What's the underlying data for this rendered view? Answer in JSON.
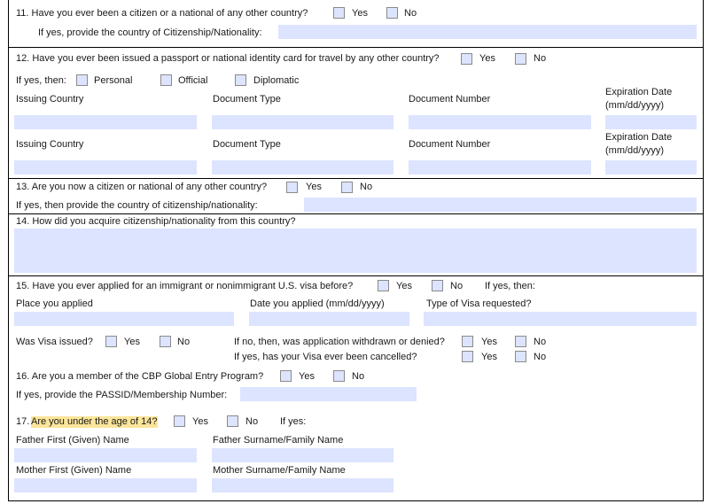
{
  "q11": {
    "text": "11. Have you ever been a citizen or a national of any other country?",
    "yes": "Yes",
    "no": "No",
    "followup": "If yes, provide the country of Citizenship/Nationality:"
  },
  "q12": {
    "text": "12. Have you ever been issued a passport or national identity card for travel by any other country?",
    "yes": "Yes",
    "no": "No",
    "if_yes": "If yes, then:",
    "personal": "Personal",
    "official": "Official",
    "diplomatic": "Diplomatic",
    "issuing_country": "Issuing Country",
    "document_type": "Document Type",
    "document_number": "Document Number",
    "exp_date_1": "Expiration Date",
    "exp_date_2": "(mm/dd/yyyy)"
  },
  "q13": {
    "text": "13. Are you now a citizen or national of any other country?",
    "yes": "Yes",
    "no": "No",
    "followup": "If yes, then provide the country of citizenship/nationality:"
  },
  "q14": {
    "text": "14. How did you acquire citizenship/nationality from this country?"
  },
  "q15": {
    "text": "15. Have you ever applied for an immigrant or nonimmigrant U.S. visa before?",
    "yes": "Yes",
    "no": "No",
    "if_yes_then": "If yes, then:",
    "place": "Place you applied",
    "date": "Date you applied (mm/dd/yyyy)",
    "visa_type": "Type of Visa requested?",
    "visa_issued": "Was Visa issued?",
    "if_no": "If no, then, was application withdrawn or denied?",
    "cancelled": "If yes, has your Visa ever been cancelled?"
  },
  "q16": {
    "text": "16. Are you a member of the CBP Global Entry Program?",
    "yes": "Yes",
    "no": "No",
    "followup": "If yes, provide the PASSID/Membership Number:"
  },
  "q17": {
    "number": "17.",
    "text": "Are you under the age of 14?",
    "yes": "Yes",
    "no": "No",
    "if_yes": "If yes:",
    "father_first": "Father First (Given) Name",
    "father_surname": "Father Surname/Family Name",
    "mother_first": "Mother First (Given) Name",
    "mother_surname": "Mother Surname/Family Name"
  },
  "colors": {
    "field_fill": "#dde4ff",
    "highlight": "#fbe59a"
  }
}
